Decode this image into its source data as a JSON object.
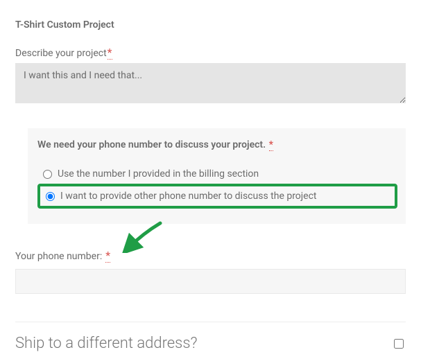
{
  "section_title": "T-Shirt Custom Project",
  "describe": {
    "label": "Describe your project",
    "required": "*",
    "placeholder": "I want this and I need that..."
  },
  "phone_section": {
    "title": "We need your phone number to discuss your project.",
    "required": "*",
    "options": {
      "use_billing": "Use the number I provided in the billing section",
      "provide_other": "I want to provide other phone number to discuss the project"
    }
  },
  "phone_field": {
    "label": "Your phone number:",
    "required": "*"
  },
  "ship_label": "Ship to a different address?"
}
